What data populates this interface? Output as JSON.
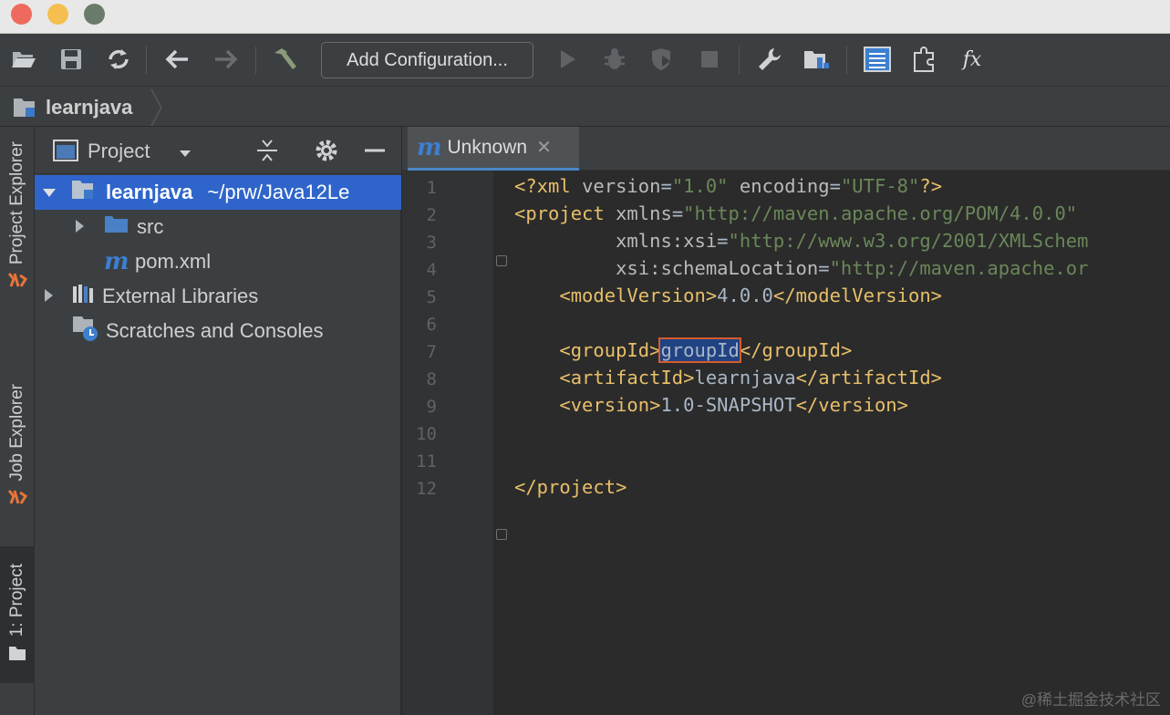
{
  "toolbar": {
    "add_configuration_label": "Add Configuration...",
    "icons": [
      "open-folder-icon",
      "save-icon",
      "sync-icon",
      "back-icon",
      "forward-icon",
      "build-hammer-icon",
      "run-icon",
      "debug-icon",
      "coverage-icon",
      "stop-icon",
      "settings-wrench-icon",
      "project-structure-icon",
      "list-view-icon",
      "puzzle-icon",
      "fx-icon"
    ]
  },
  "breadcrumb": {
    "project": "learnjava"
  },
  "stripe": {
    "tabs": [
      {
        "label": "Project Explorer"
      },
      {
        "label": "Job Explorer"
      },
      {
        "label": "1: Project"
      }
    ]
  },
  "panel": {
    "title": "Project",
    "tree": [
      {
        "label": "learnjava",
        "path": "~/prw/Java12Le"
      },
      {
        "label": "src"
      },
      {
        "label": "pom.xml"
      },
      {
        "label": "External Libraries"
      },
      {
        "label": "Scratches and Consoles"
      }
    ]
  },
  "editor": {
    "tab_label": "Unknown",
    "line_numbers": [
      "1",
      "2",
      "3",
      "4",
      "5",
      "6",
      "7",
      "8",
      "9",
      "10",
      "11",
      "12"
    ],
    "code": {
      "l1": {
        "a": "<?xml ",
        "b": "version",
        "c": "=",
        "d": "\"1.0\"",
        "e": " encoding",
        "f": "=",
        "g": "\"UTF-8\"",
        "h": "?>"
      },
      "l2": {
        "a": "<project ",
        "b": "xmlns",
        "c": "=",
        "d": "\"http://maven.apache.org/POM/4.0.0\""
      },
      "l3": {
        "a": "         xmlns",
        "b": ":xsi",
        "c": "=",
        "d": "\"http://www.w3.org/2001/XMLSchem"
      },
      "l4": {
        "a": "         xsi",
        "b": ":schemaLocation",
        "c": "=",
        "d": "\"http://maven.apache.or"
      },
      "l5": {
        "a": "    <modelVersion>",
        "b": "4.0.0",
        "c": "</modelVersion>"
      },
      "l7": {
        "a": "    <groupId>",
        "b": "groupId",
        "c": "</groupId>"
      },
      "l8": {
        "a": "    <artifactId>",
        "b": "learnjava",
        "c": "</artifactId>"
      },
      "l9": {
        "a": "    <version>",
        "b": "1.0-SNAPSHOT",
        "c": "</version>"
      },
      "l12": {
        "a": "</project>"
      }
    }
  },
  "watermark": "@稀土掘金技术社区"
}
